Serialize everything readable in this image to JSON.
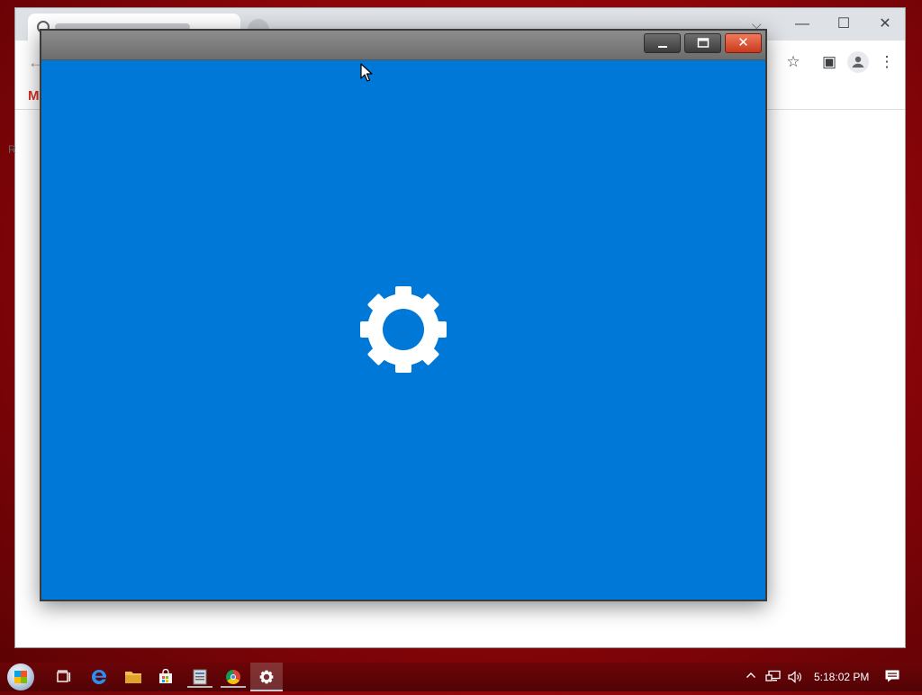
{
  "background_browser": {
    "window_controls": {
      "minimize": "—",
      "maximize": "☐",
      "close": "✕"
    },
    "tab_search_glyph": "⌵",
    "toolbar": {
      "back": "←",
      "star": "☆",
      "sidebar": "▣",
      "menu": "⋮"
    },
    "bookmark_gmail": "M",
    "edge_letter": "R"
  },
  "splash": {
    "caption": {
      "minimize": "▁",
      "maximize": "🗖",
      "close": "✕"
    },
    "background_color": "#0078d7",
    "center_icon": "gear-icon"
  },
  "taskbar": {
    "apps": [
      "task-view",
      "edge",
      "file-explorer",
      "store",
      "notes-app",
      "chrome",
      "settings"
    ],
    "clock": "5:18:02 PM",
    "tray": {
      "chevron": "^",
      "network": "🖧",
      "volume": "🔊"
    }
  }
}
